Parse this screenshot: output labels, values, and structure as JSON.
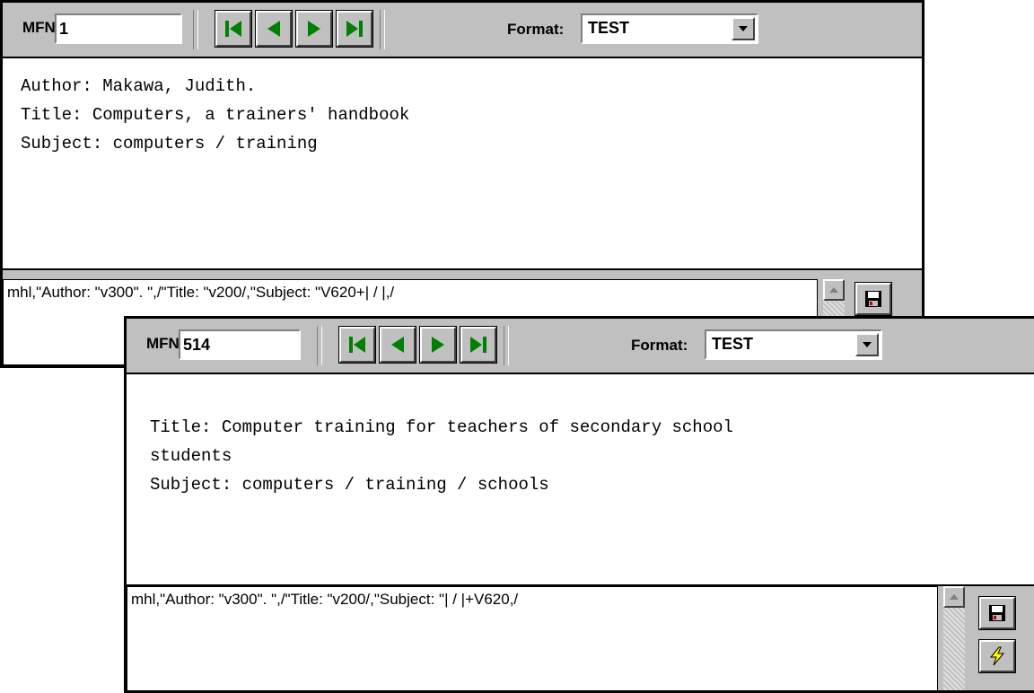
{
  "window1": {
    "mfn_label": "MFN",
    "mfn_value": "1",
    "format_label": "Format:",
    "format_value": "TEST",
    "display_lines": [
      "Author: Makawa, Judith.",
      "Title: Computers, a trainers' handbook",
      "Subject: computers / training"
    ],
    "format_expression": "mhl,\"Author: \"v300\". \",/\"Title: \"v200/,\"Subject: \"V620+| / |,/"
  },
  "window2": {
    "mfn_label": "MFN",
    "mfn_value": "514",
    "format_label": "Format:",
    "format_value": "TEST",
    "display_lines": [
      "Title: Computer training for teachers of secondary school",
      "students",
      "Subject: computers / training / schools"
    ],
    "format_expression": "mhl,\"Author: \"v300\". \",/\"Title: \"v200/,\"Subject: \"| / |+V620,/"
  },
  "icons": {
    "first": "first-record-icon",
    "previous": "previous-record-icon",
    "next": "next-record-icon",
    "last": "last-record-icon",
    "save": "floppy-disk-icon",
    "run": "lightning-icon",
    "dropdown": "chevron-down-icon"
  },
  "colors": {
    "nav_arrow": "#008000",
    "window_bg": "#c0c0c0",
    "save_icon": "#c00000",
    "run_icon": "#ffff00"
  }
}
